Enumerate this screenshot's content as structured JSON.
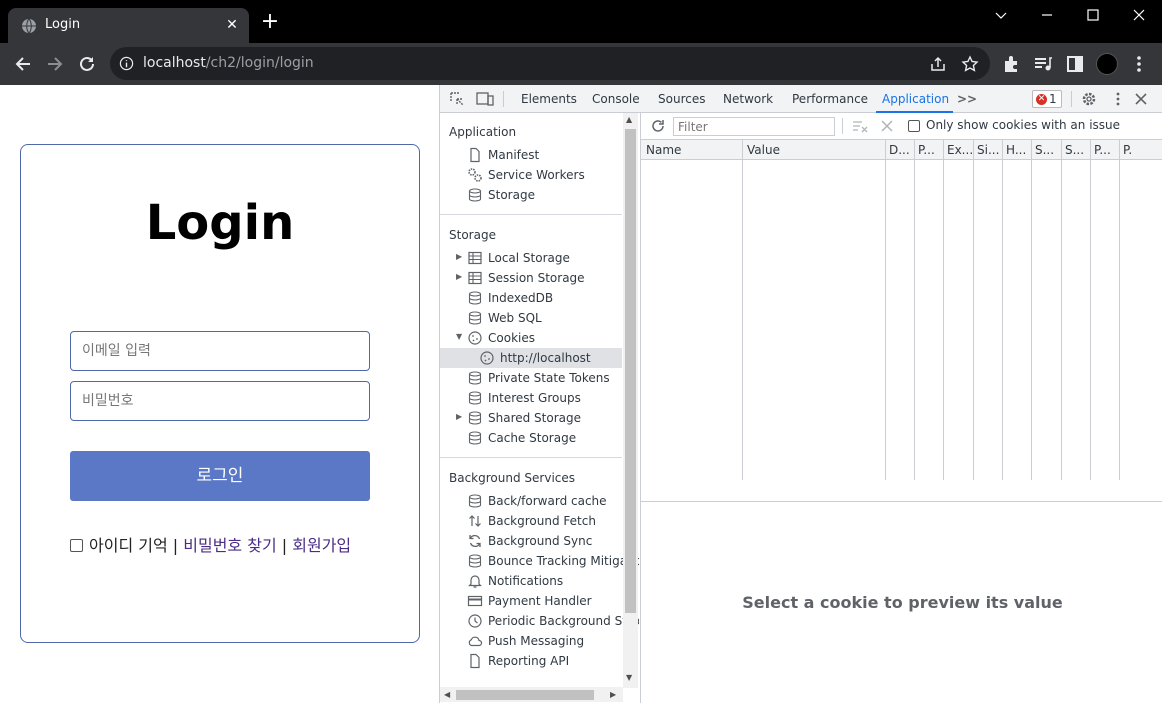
{
  "browser": {
    "tab_title": "Login",
    "tab_close": "✕",
    "new_tab": "+",
    "url_host": "localhost",
    "url_path": "/ch2/login/login"
  },
  "login": {
    "title": "Login",
    "email_placeholder": "이메일 입력",
    "password_placeholder": "비밀번호",
    "button_label": "로그인",
    "remember_label": "아이디 기억",
    "separator": "|",
    "find_password": "비밀번호 찾기",
    "signup": "회원가입"
  },
  "devtools": {
    "tabs": [
      "Elements",
      "Console",
      "Sources",
      "Network",
      "Performance",
      "Application"
    ],
    "more_tabs": ">>",
    "active_tab": "Application",
    "error_count": "1",
    "sidebar": {
      "application_header": "Application",
      "application_items": [
        "Manifest",
        "Service Workers",
        "Storage"
      ],
      "storage_header": "Storage",
      "storage_items": [
        "Local Storage",
        "Session Storage",
        "IndexedDB",
        "Web SQL",
        "Cookies",
        "http://localhost",
        "Private State Tokens",
        "Interest Groups",
        "Shared Storage",
        "Cache Storage"
      ],
      "background_header": "Background Services",
      "background_items": [
        "Back/forward cache",
        "Background Fetch",
        "Background Sync",
        "Bounce Tracking Mitigatio",
        "Notifications",
        "Payment Handler",
        "Periodic Background Sync",
        "Push Messaging",
        "Reporting API"
      ]
    },
    "cookies": {
      "filter_placeholder": "Filter",
      "issue_only_label": "Only show cookies with an issue",
      "columns": [
        "Name",
        "Value",
        "D...",
        "P...",
        "Ex...",
        "Si...",
        "H...",
        "S...",
        "S...",
        "P...",
        "P."
      ],
      "preview_message": "Select a cookie to preview its value"
    }
  },
  "colors": {
    "accent": "#1a73e8",
    "login_button": "#5b78c7",
    "card_border": "#4f68a8",
    "link": "#4b2c86"
  }
}
